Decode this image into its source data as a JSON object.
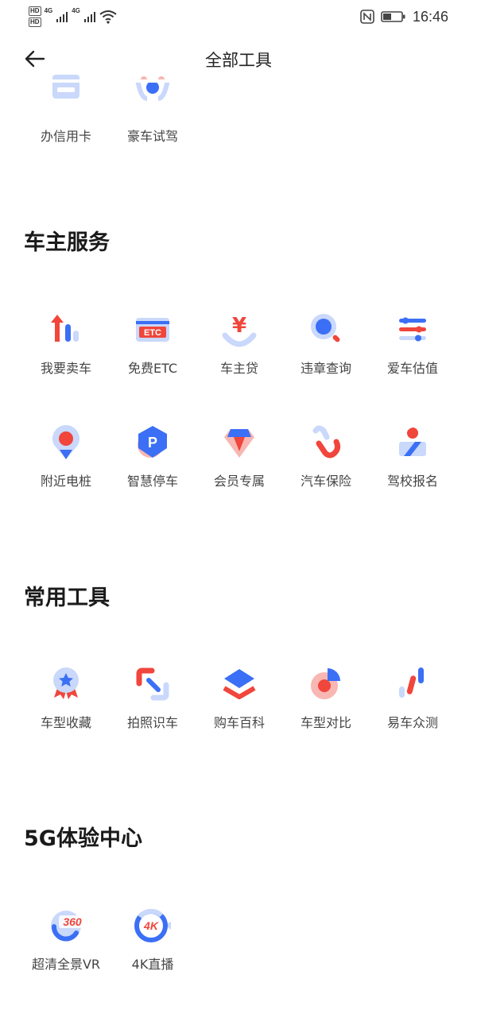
{
  "status_bar": {
    "hd1": "HD",
    "hd2": "HD",
    "net1": "4G",
    "net2": "4G",
    "time": "16:46"
  },
  "nav": {
    "title": "全部工具"
  },
  "partial_row": [
    {
      "label": "办信用卡",
      "icon": "credit-card-icon"
    },
    {
      "label": "豪车试驾",
      "icon": "steering-wheel-icon"
    }
  ],
  "sections": {
    "owner": {
      "title": "车主服务",
      "items": [
        {
          "label": "我要卖车",
          "icon": "sell-car-icon"
        },
        {
          "label": "免费ETC",
          "icon": "etc-card-icon",
          "badge": "ETC"
        },
        {
          "label": "车主贷",
          "icon": "loan-yen-icon",
          "symbol": "¥"
        },
        {
          "label": "违章查询",
          "icon": "search-violation-icon"
        },
        {
          "label": "爱车估值",
          "icon": "sliders-icon"
        },
        {
          "label": "附近电桩",
          "icon": "location-pin-icon"
        },
        {
          "label": "智慧停车",
          "icon": "parking-icon",
          "symbol": "P"
        },
        {
          "label": "会员专属",
          "icon": "diamond-icon"
        },
        {
          "label": "汽车保险",
          "icon": "insurance-link-icon"
        },
        {
          "label": "驾校报名",
          "icon": "driving-school-icon"
        }
      ]
    },
    "tools": {
      "title": "常用工具",
      "items": [
        {
          "label": "车型收藏",
          "icon": "medal-star-icon"
        },
        {
          "label": "拍照识车",
          "icon": "scan-corners-icon"
        },
        {
          "label": "购车百科",
          "icon": "layers-icon"
        },
        {
          "label": "车型对比",
          "icon": "pie-chart-icon"
        },
        {
          "label": "易车众测",
          "icon": "test-bars-icon"
        }
      ]
    },
    "five_g": {
      "title": "5G体验中心",
      "items": [
        {
          "label": "超清全景VR",
          "icon": "vr-360-icon",
          "symbol": "360"
        },
        {
          "label": "4K直播",
          "icon": "live-4k-icon",
          "symbol": "4K"
        }
      ]
    }
  },
  "colors": {
    "blue": "#3b6ff5",
    "red": "#f0463c",
    "light_blue": "#c9d8fb",
    "pink": "#f8b7b2"
  }
}
